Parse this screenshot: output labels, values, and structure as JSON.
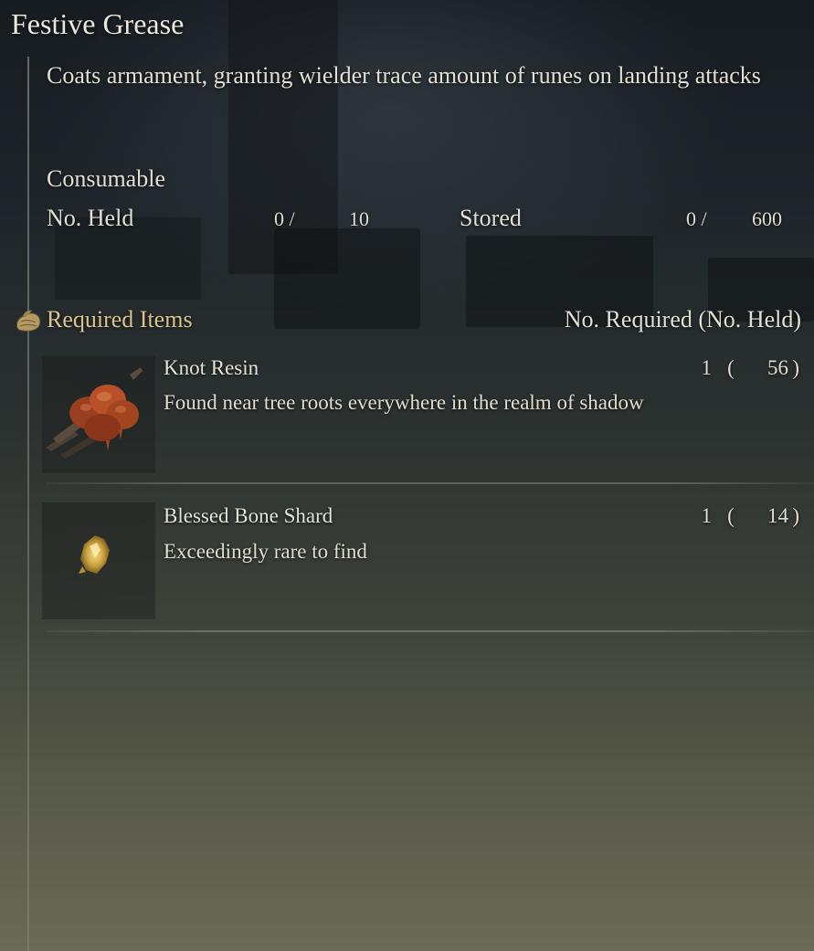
{
  "item": {
    "title": "Festive Grease",
    "description": "Coats armament, granting wielder trace amount of runes on landing attacks",
    "category": "Consumable"
  },
  "stats": {
    "held_label": "No. Held",
    "held_current": "0 /",
    "held_max": "10",
    "stored_label": "Stored",
    "stored_current": "0 /",
    "stored_max": "600"
  },
  "requirements": {
    "icon": "sack-icon",
    "label": "Required Items",
    "header": "No. Required (No. Held)",
    "items": [
      {
        "icon": "knot-resin-icon",
        "name": "Knot Resin",
        "description": "Found near tree roots everywhere in the realm of shadow",
        "required": "1",
        "open_paren": "(",
        "held": "56",
        "close_paren": ")"
      },
      {
        "icon": "blessed-bone-shard-icon",
        "name": "Blessed Bone Shard",
        "description": "Exceedingly rare to find",
        "required": "1",
        "open_paren": "(",
        "held": "14",
        "close_paren": ")"
      }
    ]
  }
}
